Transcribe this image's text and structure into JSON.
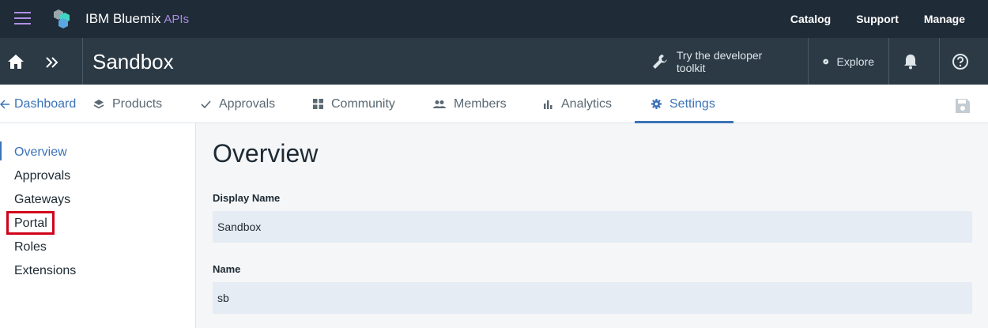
{
  "topbar": {
    "brand": "IBM Bluemix",
    "brand_sub": "APIs",
    "nav": [
      "Catalog",
      "Support",
      "Manage"
    ]
  },
  "bar2": {
    "title": "Sandbox",
    "toolkit_label": "Try the developer toolkit",
    "explore_label": "Explore"
  },
  "tabs": {
    "back_label": "Dashboard",
    "items": [
      "Products",
      "Approvals",
      "Community",
      "Members",
      "Analytics",
      "Settings"
    ],
    "active": "Settings"
  },
  "sidebar": {
    "items": [
      "Overview",
      "Approvals",
      "Gateways",
      "Portal",
      "Roles",
      "Extensions"
    ],
    "active": "Overview",
    "highlighted": "Portal"
  },
  "main": {
    "title": "Overview",
    "display_name_label": "Display Name",
    "display_name_value": "Sandbox",
    "name_label": "Name",
    "name_value": "sb"
  },
  "colors": {
    "topbar_bg": "#1f2b36",
    "bar2_bg": "#2b3a45",
    "accent": "#3b73b9",
    "brand_purple": "#a98de0",
    "highlight_red": "#d0021b"
  }
}
